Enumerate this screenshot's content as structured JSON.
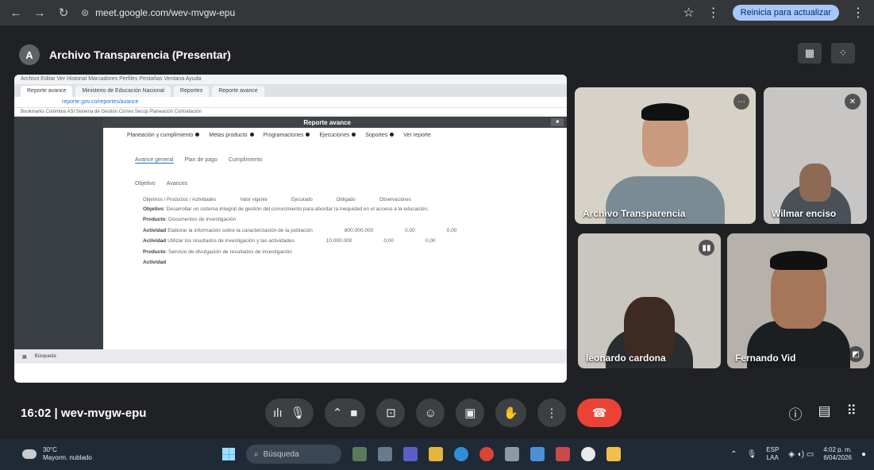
{
  "browser": {
    "url": "meet.google.com/wev-mvgw-epu",
    "reload_label": "Reinicia para actualizar"
  },
  "meet": {
    "presentation_title": "Archivo Transparencia (Presentar)",
    "presenter_initial": "A",
    "meeting_info": "16:02 | wev-mvgw-epu"
  },
  "shared_screen": {
    "menu_text": "Archivo  Editar  Ver  Historial  Marcadores  Perfiles  Pestañas  Ventana  Ayuda",
    "tabs": [
      "Reporte avance",
      "Ministerio de Educación Nacional",
      "Reportes",
      "Reporte avance"
    ],
    "address": "reporte.gov.co/reportes/avance",
    "bookmarks": "Bookmarks  Colombia  ASI  Sistema de Gestión  Correo  Secop  Planeación  Contratación",
    "header_label": "Reporte avance",
    "steps": [
      "Planeación y cumplimiento",
      "Metas producto",
      "Programaciones",
      "Ejecuciones",
      "Soportes",
      "Ver reporte"
    ],
    "subtabs_1": [
      "Avance general",
      "Plan de pago",
      "Cumplimiento"
    ],
    "subtabs_2": [
      "Objetivo",
      "Avances"
    ],
    "table_headers": [
      "Objetivos / Productos / Actividades",
      "Valor vigente",
      "Ejecutado",
      "Obligado",
      "Observaciones"
    ],
    "rows": [
      {
        "label": "Objetivo",
        "text": "Desarrollar un sistema integral de gestión del conocimiento para abordar la inequidad en el acceso a la educación."
      },
      {
        "label": "Producto",
        "text": "Documentos de investigación"
      },
      {
        "label": "Actividad",
        "text": "Elaborar la información sobre la caracterización de la población",
        "v1": "800.000.000",
        "v2": "0,00",
        "v3": "0,00"
      },
      {
        "label": "Actividad",
        "text": "Utilizar los resultados de investigación y las actividades",
        "v1": "10.000.000",
        "v2": "0,00",
        "v3": "0,00"
      },
      {
        "label": "Producto",
        "text": "Servicio de divulgación de resultados de investigación"
      },
      {
        "label": "Actividad",
        "text": ""
      }
    ],
    "taskbar_search": "Búsqueda"
  },
  "participants": [
    {
      "name": "Archivo Transparencia",
      "shirt": "#7a8b93"
    },
    {
      "name": "Wilmar enciso",
      "shirt": "#4a5058"
    },
    {
      "name": "leonardo cardona",
      "shirt": "#2a2d30"
    },
    {
      "name": "Fernando Vid",
      "shirt": "#1c1f22"
    }
  ],
  "controls": {
    "captions_icon": "captions-icon",
    "mic_icon": "mic-icon",
    "expand_icon": "chevron-up-icon",
    "camera_icon": "camera-icon",
    "present_icon": "present-icon",
    "emoji_icon": "emoji-icon",
    "cc_icon": "closed-captions-icon",
    "hand_icon": "raise-hand-icon",
    "more_icon": "more-icon",
    "end_icon": "end-call-icon"
  },
  "taskbar": {
    "weather_temp": "30°C",
    "weather_desc": "Mayorm. nublado",
    "search": "Búsqueda",
    "lang_top": "ESP",
    "lang_bottom": "LAA",
    "time": "4:02 p. m.",
    "date": "6/04/2026"
  },
  "colors": {
    "meet_bg": "#202124",
    "end_call": "#ea4335",
    "taskbar_bg": "#1f2a36"
  }
}
